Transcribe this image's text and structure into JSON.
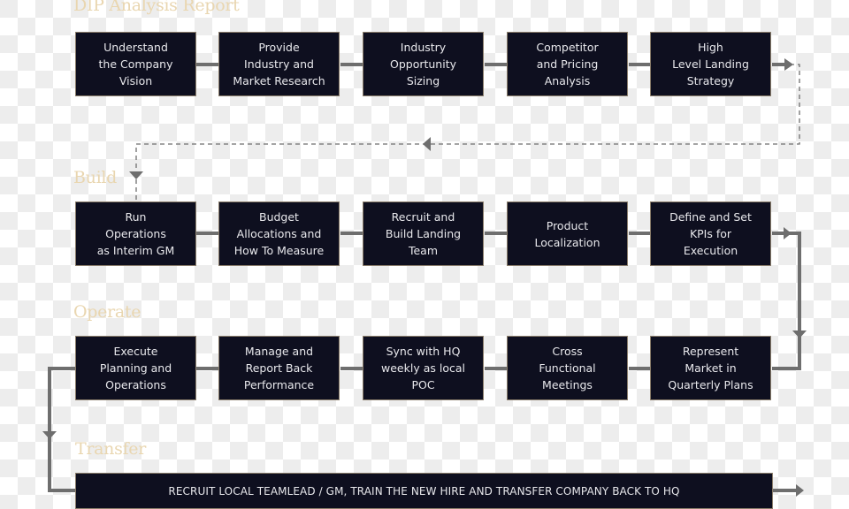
{
  "colors": {
    "box_fill": "#0e0f1f",
    "box_border": "#8a7d6b",
    "box_text": "#e8e8ec",
    "section_title": "#e9d6b0",
    "connector": "#6e6e6e"
  },
  "sections": [
    {
      "title": "DIP Analysis Report",
      "steps": [
        {
          "label": "Understand\nthe Company\nVision"
        },
        {
          "label": "Provide\nIndustry and\nMarket Research"
        },
        {
          "label": "Industry\nOpportunity\nSizing"
        },
        {
          "label": "Competitor\nand Pricing\nAnalysis"
        },
        {
          "label": "High\nLevel Landing\nStrategy"
        }
      ]
    },
    {
      "title": "Build",
      "steps": [
        {
          "label": "Run\nOperations\nas Interim GM"
        },
        {
          "label": "Budget\nAllocations and\nHow To Measure"
        },
        {
          "label": "Recruit and\nBuild Landing\nTeam"
        },
        {
          "label": "Product\nLocalization"
        },
        {
          "label": "Define and Set\nKPIs for\nExecution"
        }
      ]
    },
    {
      "title": "Operate",
      "steps": [
        {
          "label": "Execute\nPlanning and\nOperations"
        },
        {
          "label": "Manage and\nReport Back\nPerformance"
        },
        {
          "label": "Sync with HQ\nweekly as local\nPOC"
        },
        {
          "label": "Cross\nFunctional\nMeetings"
        },
        {
          "label": "Represent\nMarket in\nQuarterly Plans"
        }
      ]
    },
    {
      "title": "Transfer",
      "steps": [
        {
          "label": "RECRUIT LOCAL TEAMLEAD / GM, TRAIN THE NEW HIRE AND TRANSFER COMPANY BACK TO HQ"
        }
      ]
    }
  ]
}
